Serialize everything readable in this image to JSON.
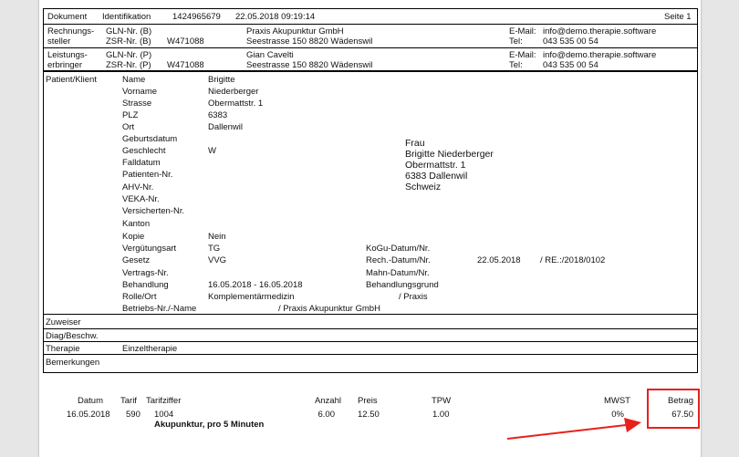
{
  "header": {
    "dokument_label": "Dokument",
    "identifikation_label": "Identifikation",
    "identifikation_value": "1424965679",
    "datetime": "22.05.2018 09:19:14",
    "page": "Seite 1"
  },
  "rechnungssteller": {
    "label_line1": "Rechnungs-",
    "label_line2": "steller",
    "gln_label": "GLN-Nr. (B)",
    "zsr_label": "ZSR-Nr. (B)",
    "zsr_value": "W471088",
    "name": "Praxis Akupunktur GmbH",
    "address": "Seestrasse 150 8820 Wädenswil",
    "email_label": "E-Mail:",
    "email_value": "info@demo.therapie.software",
    "tel_label": "Tel:",
    "tel_value": "043 535 00 54"
  },
  "leistungserbringer": {
    "label_line1": "Leistungs-",
    "label_line2": "erbringer",
    "gln_label": "GLN-Nr. (P)",
    "zsr_label": "ZSR-Nr. (P)",
    "zsr_value": "W471088",
    "name": "Gian Cavelti",
    "address": "Seestrasse 150 8820 Wädenswil",
    "email_label": "E-Mail:",
    "email_value": "info@demo.therapie.software",
    "tel_label": "Tel:",
    "tel_value": "043 535 00 54"
  },
  "patient": {
    "section_label": "Patient/Klient",
    "fields": [
      {
        "label": "Name",
        "value": "Brigitte"
      },
      {
        "label": "Vorname",
        "value": "Niederberger"
      },
      {
        "label": "Strasse",
        "value": "Obermattstr. 1"
      },
      {
        "label": "PLZ",
        "value": "6383"
      },
      {
        "label": "Ort",
        "value": "Dallenwil"
      },
      {
        "label": "Geburtsdatum",
        "value": ""
      },
      {
        "label": "Geschlecht",
        "value": "W"
      },
      {
        "label": "Falldatum",
        "value": ""
      },
      {
        "label": "Patienten-Nr.",
        "value": ""
      },
      {
        "label": "AHV-Nr.",
        "value": ""
      },
      {
        "label": "VEKA-Nr.",
        "value": ""
      },
      {
        "label": "Versicherten-Nr.",
        "value": ""
      },
      {
        "label": "Kanton",
        "value": ""
      },
      {
        "label": "Kopie",
        "value": "Nein"
      },
      {
        "label": "Vergütungsart",
        "value": "TG"
      },
      {
        "label": "Gesetz",
        "value": "VVG"
      },
      {
        "label": "Vertrags-Nr.",
        "value": ""
      },
      {
        "label": "Behandlung",
        "value": "16.05.2018 - 16.05.2018"
      },
      {
        "label": "Rolle/Ort",
        "value": "Komplementärmedizin"
      },
      {
        "label": "Betriebs-Nr./-Name",
        "value": ""
      }
    ],
    "betriebs_extra": "/ Praxis Akupunktur GmbH",
    "address_block": [
      "Frau",
      "Brigitte Niederberger",
      "Obermattstr. 1",
      "6383 Dallenwil",
      "Schweiz"
    ],
    "kogu_label": "KoGu-Datum/Nr.",
    "rech_label": "Rech.-Datum/Nr.",
    "rech_date": "22.05.2018",
    "rech_nr": "/ RE.:/2018/0102",
    "mahn_label": "Mahn-Datum/Nr.",
    "behandlungsgrund_label": "Behandlungsgrund",
    "rolle_extra": "/ Praxis"
  },
  "sections": {
    "zuweiser": "Zuweiser",
    "diag": "Diag/Beschw.",
    "therapie_label": "Therapie",
    "therapie_value": "Einzeltherapie",
    "bemerkungen": "Bemerkungen"
  },
  "table": {
    "headers": {
      "datum": "Datum",
      "tarif": "Tarif",
      "tarifziffer": "Tarifziffer",
      "anzahl": "Anzahl",
      "preis": "Preis",
      "tpw": "TPW",
      "mwst": "MWST",
      "betrag": "Betrag"
    },
    "row": {
      "datum": "16.05.2018",
      "tarif": "590",
      "tarifziffer": "1004",
      "description": "Akupunktur, pro 5 Minuten",
      "anzahl": "6.00",
      "preis": "12.50",
      "tpw": "1.00",
      "mwst": "0%",
      "betrag": "67.50"
    }
  },
  "annotation": {
    "color": "#e8201b"
  }
}
